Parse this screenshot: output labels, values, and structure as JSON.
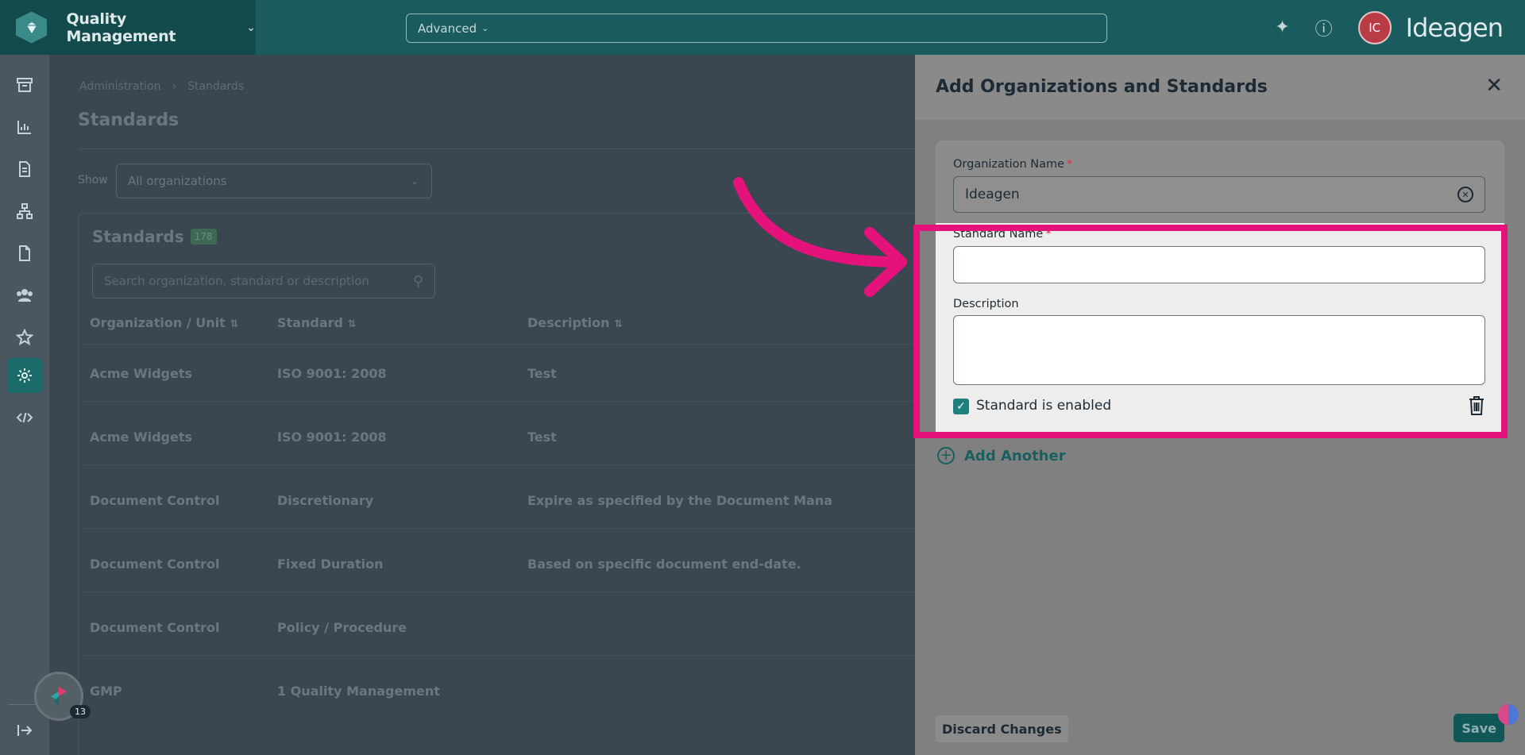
{
  "topbar": {
    "product": "Quality Management",
    "search_mode": "Advanced",
    "avatar_initials": "IC",
    "brand_logo_text": "Ideagen"
  },
  "sidebar": {
    "items": [
      "archive-icon",
      "chart-icon",
      "document-icon",
      "hierarchy-icon",
      "file-icon",
      "people-icon",
      "star-icon",
      "gear-icon",
      "code-icon"
    ],
    "active": "gear-icon",
    "collapse_icon": "expand-arrow-icon"
  },
  "page": {
    "breadcrumb": [
      "Administration",
      "Standards"
    ],
    "title": "Standards",
    "show_label": "Show",
    "show_value": "All organizations",
    "card_title": "Standards",
    "count": "178",
    "search_placeholder": "Search organization, standard or description",
    "columns": [
      "Organization / Unit",
      "Standard",
      "Description"
    ],
    "rows": [
      {
        "org": "Acme Widgets",
        "standard": "ISO 9001: 2008",
        "description": "Test"
      },
      {
        "org": "Acme Widgets",
        "standard": "ISO 9001: 2008",
        "description": "Test"
      },
      {
        "org": "Document Control",
        "standard": "Discretionary",
        "description": "Expire as specified by the Document Mana"
      },
      {
        "org": "Document Control",
        "standard": "Fixed Duration",
        "description": "Based on specific document end-date."
      },
      {
        "org": "Document Control",
        "standard": "Policy / Procedure",
        "description": ""
      },
      {
        "org": "GMP",
        "standard": "1 Quality Management",
        "description": ""
      }
    ]
  },
  "panel": {
    "title": "Add Organizations and Standards",
    "org_label": "Organization Name",
    "org_value": "Ideagen",
    "standard_label": "Standard Name",
    "standard_value": "",
    "description_label": "Description",
    "description_value": "",
    "enabled_label": "Standard is enabled",
    "enabled": true,
    "add_another": "Add Another",
    "discard": "Discard Changes",
    "save": "Save",
    "required_mark": "*"
  },
  "helper": {
    "badge_count": "13"
  },
  "colors": {
    "accent": "#1a5c5e",
    "highlight": "#e4127a",
    "required": "#d0343f"
  }
}
